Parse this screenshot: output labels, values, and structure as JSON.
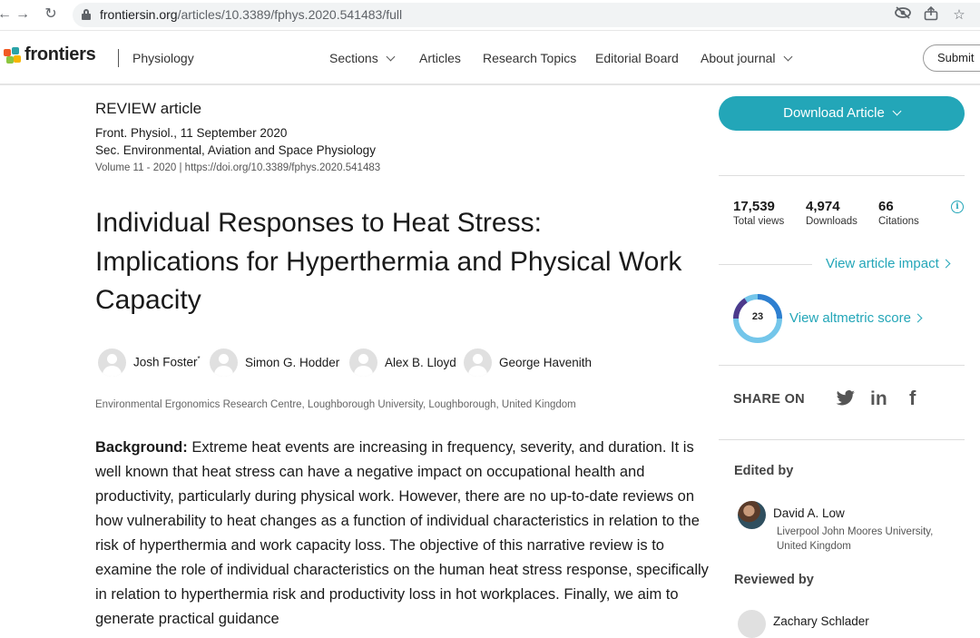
{
  "browser": {
    "url_host": "frontiersin.org",
    "url_path": "/articles/10.3389/fphys.2020.541483/full",
    "icons": [
      "back-arrow-icon",
      "forward-arrow-icon",
      "reload-icon",
      "lock-icon",
      "eye-off-icon",
      "share-icon",
      "star-icon"
    ]
  },
  "header": {
    "logo_text": "frontiers",
    "journal": "Physiology",
    "nav": [
      "Sections",
      "Articles",
      "Research Topics",
      "Editorial Board",
      "About journal"
    ],
    "submit_label": "Submit",
    "logo_colors": [
      "#f15a24",
      "#2aa3a8",
      "#8cc63f",
      "#f7b500"
    ]
  },
  "article": {
    "type": "REVIEW article",
    "journal_date": "Front. Physiol., 11 September 2020",
    "section": "Sec. Environmental, Aviation and Space Physiology",
    "volume": "Volume 11 - 2020 | https://doi.org/10.3389/fphys.2020.541483",
    "title": "Individual Responses to Heat Stress: Implications for Hyperthermia and Physical Work Capacity",
    "authors": [
      {
        "name": "Josh Foster",
        "mark": "*"
      },
      {
        "name": "Simon G. Hodder",
        "mark": ""
      },
      {
        "name": "Alex B. Lloyd",
        "mark": ""
      },
      {
        "name": "George Havenith",
        "mark": ""
      }
    ],
    "affiliation": "Environmental Ergonomics Research Centre, Loughborough University, Loughborough, United Kingdom",
    "abstract_label": "Background:",
    "abstract_text": " Extreme heat events are increasing in frequency, severity, and duration. It is well known that heat stress can have a negative impact on occupational health and productivity, particularly during physical work. However, there are no up-to-date reviews on how vulnerability to heat changes as a function of individual characteristics in relation to the risk of hyperthermia and work capacity loss. The objective of this narrative review is to examine the role of individual characteristics on the human heat stress response, specifically in relation to hyperthermia risk and productivity loss in hot workplaces. Finally, we aim to generate practical guidance"
  },
  "sidebar": {
    "download_label": "Download Article",
    "metrics": [
      {
        "value": "17,539",
        "label": "Total views"
      },
      {
        "value": "4,974",
        "label": "Downloads"
      },
      {
        "value": "66",
        "label": "Citations"
      }
    ],
    "impact_link": "View article impact",
    "altmetric_score": "23",
    "altmetric_link": "View altmetric score",
    "share_label": "SHARE ON",
    "social_icons": [
      "twitter-icon",
      "linkedin-icon",
      "facebook-icon"
    ],
    "edited_by_label": "Edited by",
    "editor_name": "David A. Low",
    "editor_affiliation": "Liverpool John Moores University, United Kingdom",
    "reviewed_by_label": "Reviewed by",
    "reviewer_name": "Zachary Schlader"
  },
  "colors": {
    "accent": "#23a6b8",
    "text": "#1a1a1a"
  }
}
